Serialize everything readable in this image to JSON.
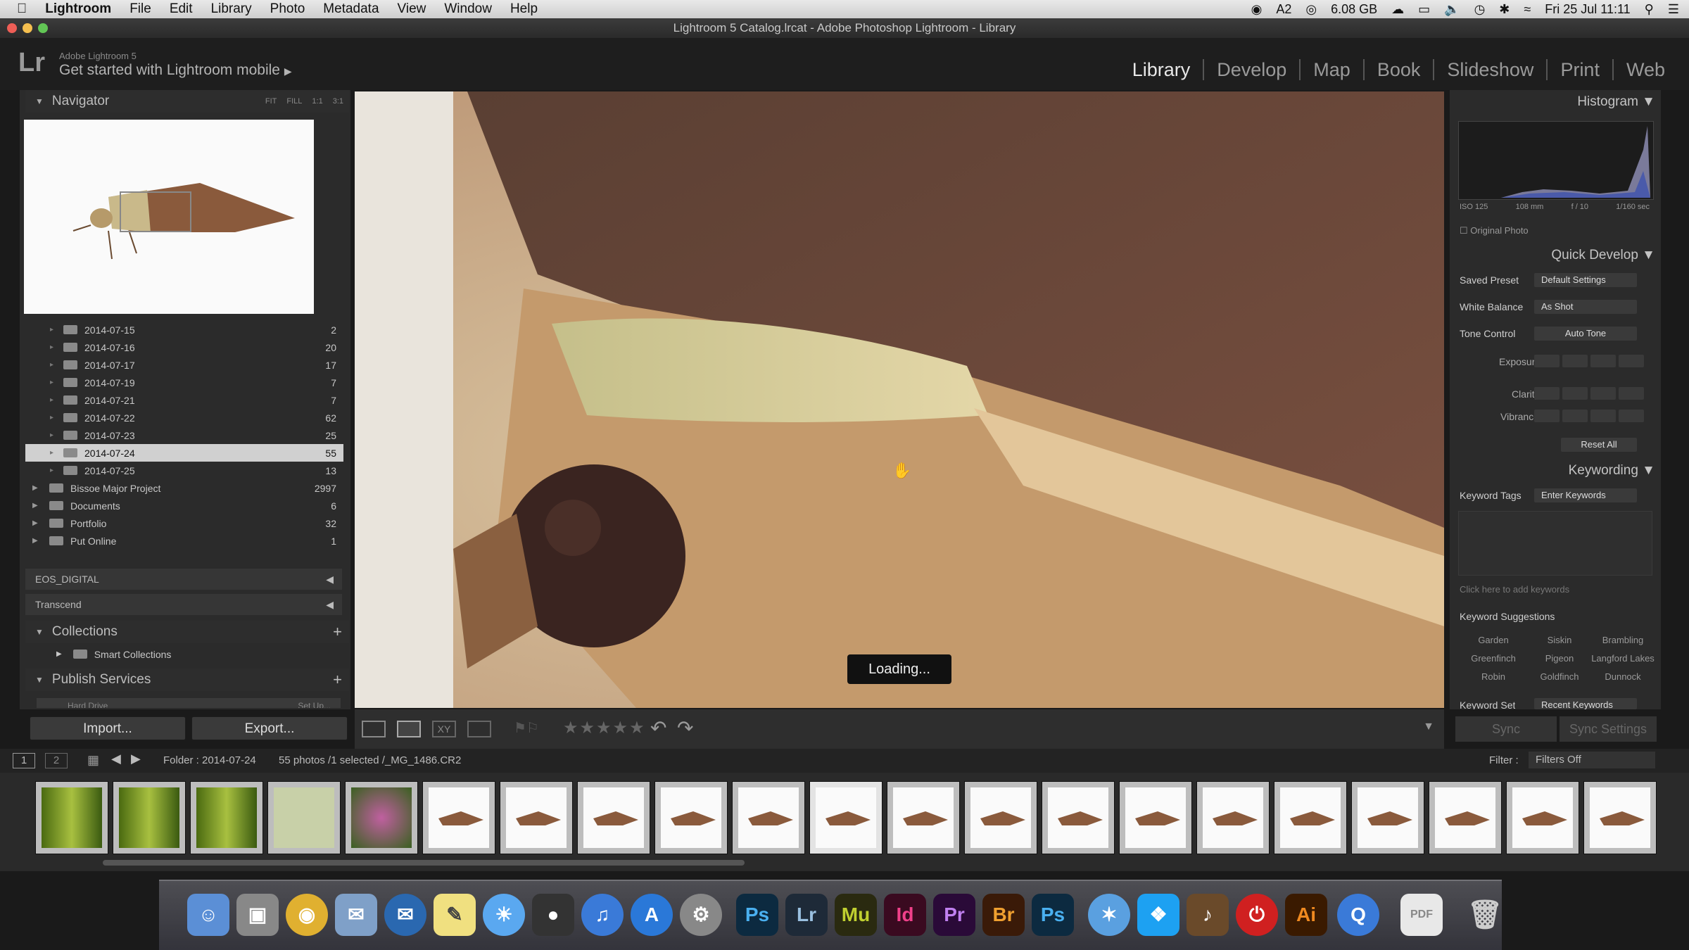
{
  "menubar": {
    "app": "Lightroom",
    "items": [
      "File",
      "Edit",
      "Library",
      "Photo",
      "Metadata",
      "View",
      "Window",
      "Help"
    ],
    "status": {
      "memory": "6.08 GB",
      "clock": "Fri 25 Jul  11:11",
      "badge": "2"
    }
  },
  "window_title": "Lightroom 5 Catalog.lrcat - Adobe Photoshop Lightroom - Library",
  "identity": {
    "logo": "Lr",
    "version": "Adobe Lightroom 5",
    "mobile": "Get started with Lightroom mobile"
  },
  "modules": [
    "Library",
    "Develop",
    "Map",
    "Book",
    "Slideshow",
    "Print",
    "Web"
  ],
  "navigator": {
    "title": "Navigator",
    "zoom": [
      "FIT",
      "FILL",
      "1:1",
      "3:1"
    ]
  },
  "folders": [
    {
      "name": "2014-07-15",
      "count": "2"
    },
    {
      "name": "2014-07-16",
      "count": "20"
    },
    {
      "name": "2014-07-17",
      "count": "17"
    },
    {
      "name": "2014-07-19",
      "count": "7"
    },
    {
      "name": "2014-07-21",
      "count": "7"
    },
    {
      "name": "2014-07-22",
      "count": "62"
    },
    {
      "name": "2014-07-23",
      "count": "25"
    },
    {
      "name": "2014-07-24",
      "count": "55"
    },
    {
      "name": "2014-07-25",
      "count": "13"
    }
  ],
  "top_folders": [
    {
      "name": "Bissoe Major Project",
      "count": "2997"
    },
    {
      "name": "Documents",
      "count": "6"
    },
    {
      "name": "Portfolio",
      "count": "32"
    },
    {
      "name": "Put Online",
      "count": "1"
    }
  ],
  "volumes": [
    "EOS_DIGITAL",
    "Transcend"
  ],
  "collections": {
    "title": "Collections",
    "smart": "Smart Collections"
  },
  "publish": {
    "title": "Publish Services",
    "hard_drive": "Hard Drive",
    "setup": "Set Up..."
  },
  "buttons": {
    "import": "Import...",
    "export": "Export...",
    "sync": "Sync",
    "sync_settings": "Sync Settings"
  },
  "loading": "Loading...",
  "histogram": {
    "title": "Histogram",
    "iso": "ISO 125",
    "focal": "108 mm",
    "aperture": "f / 10",
    "shutter": "1/160 sec",
    "original": "Original Photo"
  },
  "quick_develop": {
    "title": "Quick Develop",
    "saved_preset_label": "Saved Preset",
    "saved_preset": "Default Settings",
    "wb_label": "White Balance",
    "wb": "As Shot",
    "tone_label": "Tone Control",
    "auto_tone": "Auto Tone",
    "exposure": "Exposure",
    "clarity": "Clarity",
    "vibrance": "Vibrance",
    "reset": "Reset All"
  },
  "keywording": {
    "title": "Keywording",
    "tags_label": "Keyword Tags",
    "tags_value": "Enter Keywords",
    "placeholder": "Click here to add keywords",
    "suggestions_label": "Keyword Suggestions",
    "suggestions": [
      "Garden",
      "Siskin",
      "Brambling",
      "Greenfinch",
      "Pigeon",
      "Langford Lakes",
      "Robin",
      "Goldfinch",
      "Dunnock"
    ],
    "set_label": "Keyword Set",
    "set_value": "Recent Keywords"
  },
  "filmbar": {
    "folder": "Folder : 2014-07-24",
    "selection": "55 photos /1 selected /_MG_1486.CR2",
    "filter_label": "Filter :",
    "filter": "Filters Off",
    "view1": "1",
    "view2": "2"
  },
  "dock": [
    "Ps",
    "Lr",
    "Mu",
    "Id",
    "Pr",
    "Br",
    "Ps",
    "Ai"
  ]
}
